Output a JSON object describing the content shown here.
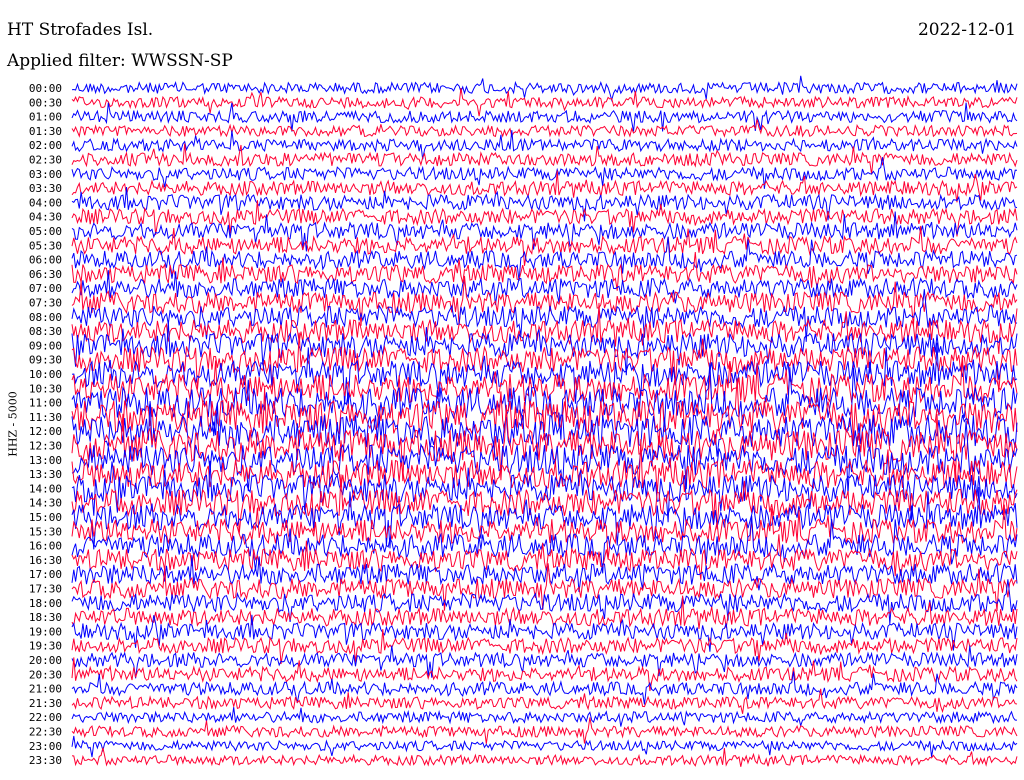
{
  "header": {
    "station": "HT Strofades Isl.",
    "date": "2022-12-01",
    "filter": "Applied filter: WWSSN-SP"
  },
  "chart_data": {
    "type": "line",
    "title": "HT Strofades Isl.",
    "subtitle": "Applied filter: WWSSN-SP",
    "date": "2022-12-01",
    "ylabel": "HHZ - 5000",
    "xlabel": "",
    "ytick_labels": [
      "00:00",
      "00:30",
      "01:00",
      "01:30",
      "02:00",
      "02:30",
      "03:00",
      "03:30",
      "04:00",
      "04:30",
      "05:00",
      "05:30",
      "06:00",
      "06:30",
      "07:00",
      "07:30",
      "08:00",
      "08:30",
      "09:00",
      "09:30",
      "10:00",
      "10:30",
      "11:00",
      "11:30",
      "12:00",
      "12:30",
      "13:00",
      "13:30",
      "14:00",
      "14:30",
      "15:00",
      "15:30",
      "16:00",
      "16:30",
      "17:00",
      "17:30",
      "18:00",
      "18:30",
      "19:00",
      "19:30",
      "20:00",
      "20:30",
      "21:00",
      "21:30",
      "22:00",
      "22:30",
      "23:00",
      "23:30"
    ],
    "trace_colors": [
      "#0000ff",
      "#ff0033"
    ],
    "trace_amplitude": [
      1.0,
      1.0,
      1.1,
      1.0,
      1.1,
      1.2,
      1.2,
      1.3,
      1.4,
      1.4,
      1.5,
      1.6,
      1.6,
      1.7,
      1.8,
      1.9,
      2.0,
      2.1,
      2.2,
      2.3,
      2.4,
      2.6,
      2.8,
      3.0,
      3.0,
      2.9,
      2.8,
      2.6,
      2.5,
      2.4,
      2.3,
      2.2,
      2.1,
      2.0,
      1.9,
      1.8,
      1.7,
      1.6,
      1.5,
      1.4,
      1.3,
      1.3,
      1.2,
      1.1,
      1.0,
      1.0,
      0.9,
      0.9
    ],
    "grid": false,
    "legend": "none"
  }
}
